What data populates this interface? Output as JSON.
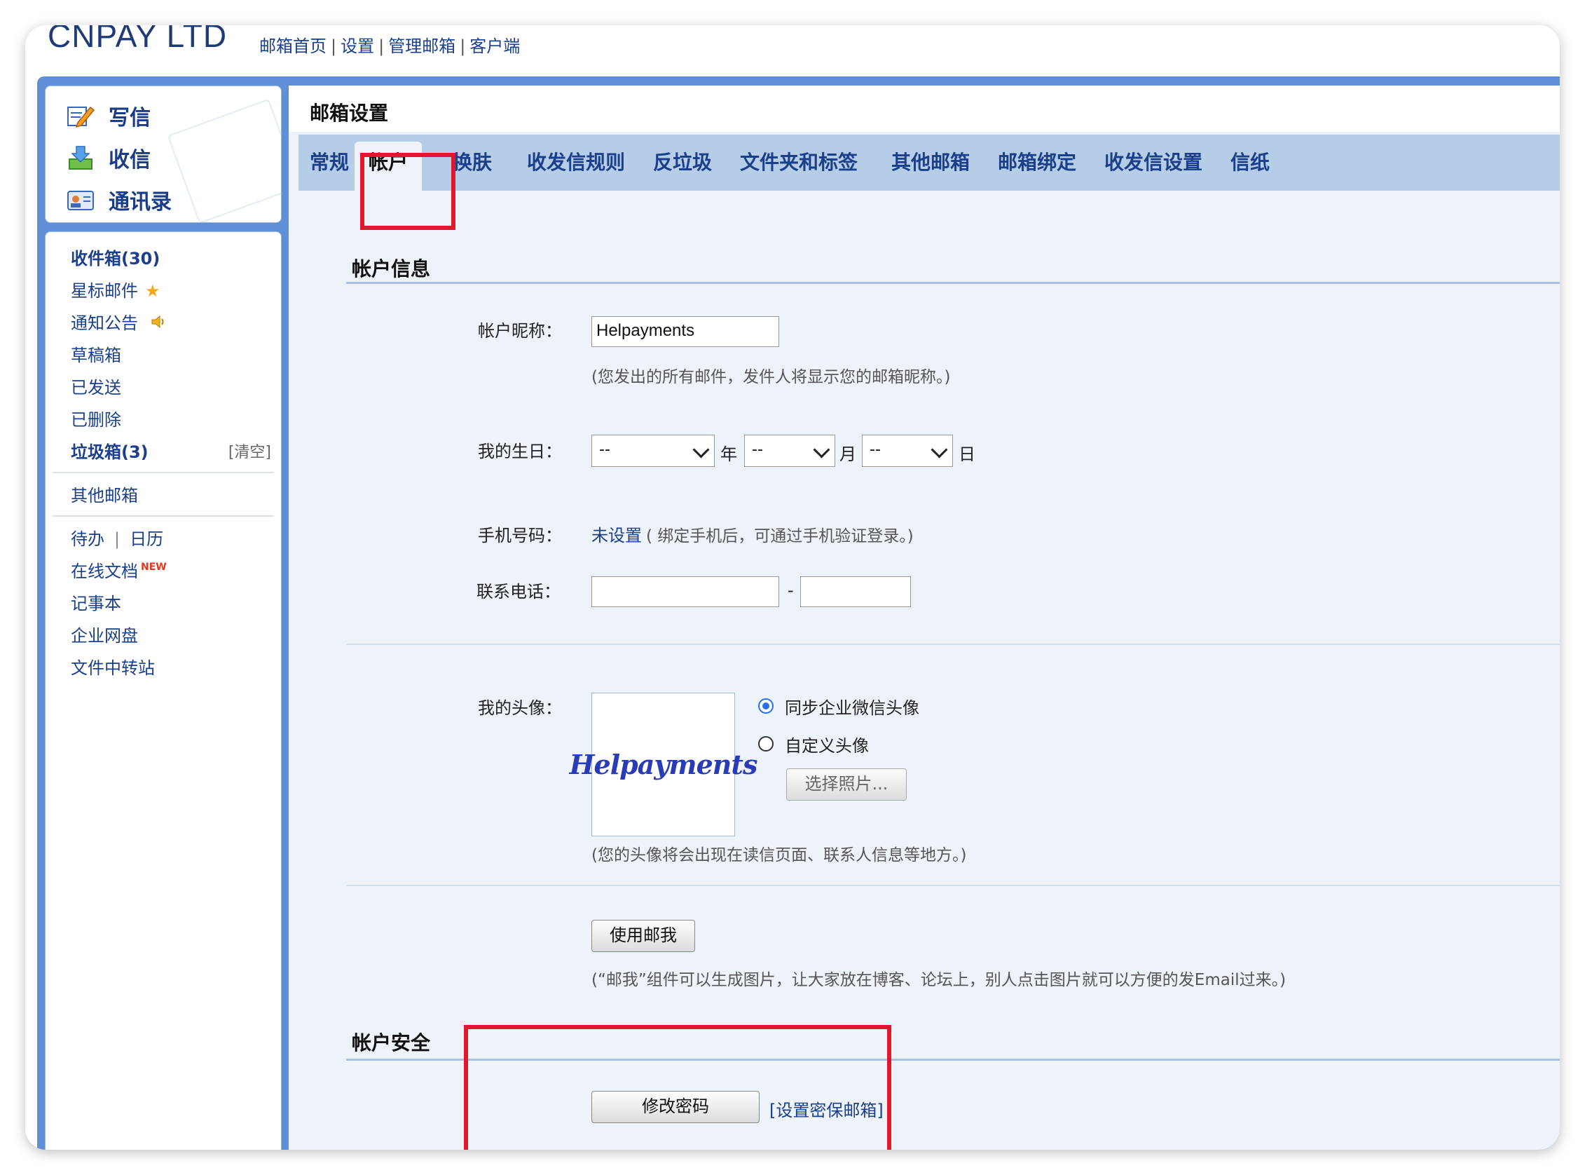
{
  "header": {
    "brand": "CNPAY LTD",
    "links": [
      "邮箱首页",
      "设置",
      "管理邮箱",
      "客户端"
    ],
    "separator": "|"
  },
  "sidebar": {
    "compose": "写信",
    "receive": "收信",
    "contacts": "通讯录",
    "folders": {
      "inbox": "收件箱(30)",
      "starred": "星标邮件",
      "notice": "通知公告",
      "drafts": "草稿箱",
      "sent": "已发送",
      "deleted": "已删除",
      "spam": "垃圾箱(3)",
      "spam_clear": "[清空]",
      "other_mail": "其他邮箱"
    },
    "tools": {
      "todo": "待办",
      "tools_sep": "|",
      "calendar": "日历",
      "docs": "在线文档",
      "docs_badge": "NEW",
      "notes": "记事本",
      "disk": "企业网盘",
      "transfer": "文件中转站"
    }
  },
  "main": {
    "title": "邮箱设置",
    "tabs": [
      "常规",
      "帐户",
      "换肤",
      "收发信规则",
      "反垃圾",
      "文件夹和标签",
      "其他邮箱",
      "邮箱绑定",
      "收发信设置",
      "信纸"
    ],
    "active_tab": "帐户"
  },
  "account": {
    "section_title": "帐户信息",
    "nickname_label": "帐户昵称：",
    "nickname_value": "Helpayments",
    "nickname_note": "(您发出的所有邮件，发件人将显示您的邮箱昵称。)",
    "birthday_label": "我的生日：",
    "birthday_year": "--",
    "birthday_month": "--",
    "birthday_day": "--",
    "year_unit": "年",
    "month_unit": "月",
    "day_unit": "日",
    "phone_label": "手机号码：",
    "phone_link": "未设置",
    "phone_note": "( 绑定手机后，可通过手机验证登录。)",
    "tel_label": "联系电话：",
    "tel_dash": "-",
    "avatar_label": "我的头像：",
    "avatar_text": "Helpayments",
    "avatar_opt1": "同步企业微信头像",
    "avatar_opt2": "自定义头像",
    "choose_photo": "选择照片...",
    "avatar_note": "(您的头像将会出现在读信页面、联系人信息等地方。)",
    "mailme_button": "使用邮我",
    "mailme_note": "(“邮我”组件可以生成图片，让大家放在博客、论坛上，别人点击图片就可以方便的发Email过来。)"
  },
  "security": {
    "section_title": "帐户安全",
    "change_password": "修改密码",
    "set_secure_mail": "[设置密保邮箱]"
  },
  "colors": {
    "accent": "#1b3f8a",
    "frame": "#5e8fd7",
    "tabbar": "#b6cde8",
    "highlight": "#e0182d"
  }
}
